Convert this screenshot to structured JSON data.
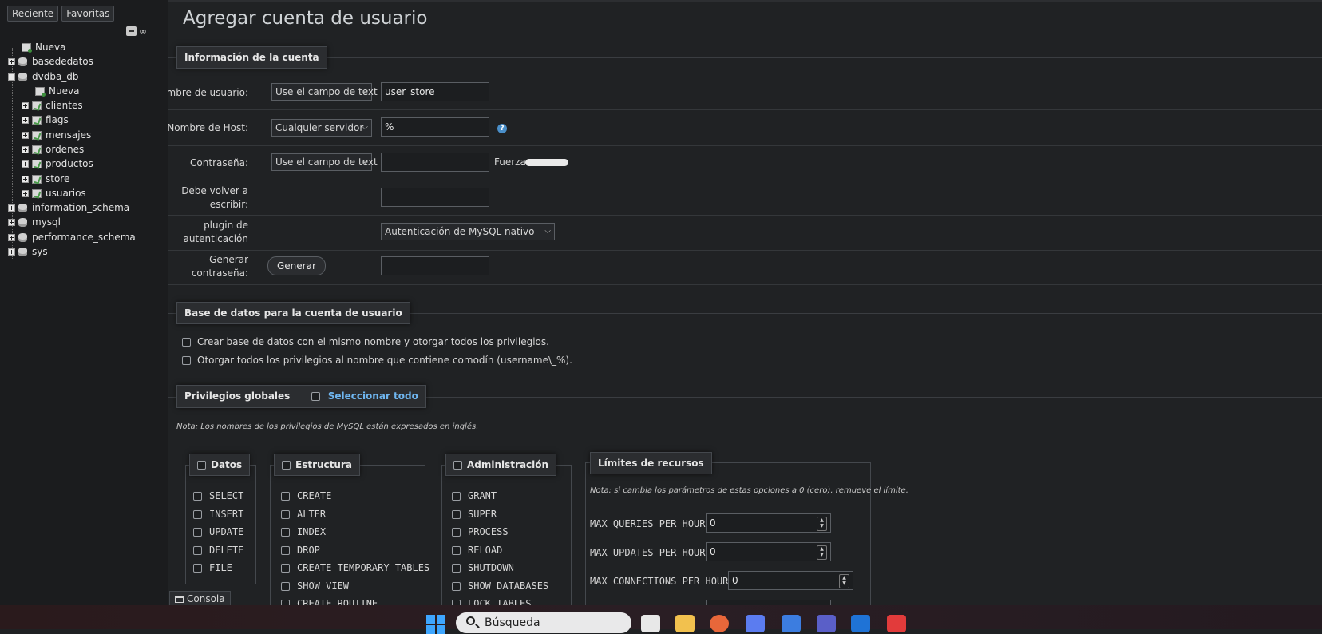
{
  "sidebar": {
    "recent_label": "Reciente",
    "favorites_label": "Favoritas",
    "link_glyph": "∞",
    "tree": {
      "new_root": "Nueva",
      "db1": "basededatos",
      "db2": "dvdba_db",
      "db2_new": "Nueva",
      "tables": [
        "clientes",
        "flags",
        "mensajes",
        "ordenes",
        "productos",
        "store",
        "usuarios"
      ],
      "db3": "information_schema",
      "db4": "mysql",
      "db5": "performance_schema",
      "db6": "sys"
    }
  },
  "main": {
    "title": "Agregar cuenta de usuario",
    "account": {
      "legend": "Información de la cuenta",
      "username_label": "Nombre de usuario:",
      "username_mode": "Use el campo de text",
      "username_value": "user_store",
      "host_label": "Nombre de Host:",
      "host_mode": "Cualquier servidor",
      "host_value": "%",
      "password_label": "Contraseña:",
      "password_mode": "Use el campo de text",
      "strength_label": "Fuerza:",
      "retype_label_1": "Debe volver a",
      "retype_label_2": "escribir:",
      "plugin_label_1": "plugin de",
      "plugin_label_2": "autenticación",
      "plugin_value": "Autenticación de MySQL nativo",
      "generate_label_1": "Generar",
      "generate_label_2": "contraseña:",
      "generate_button": "Generar"
    },
    "database": {
      "legend": "Base de datos para la cuenta de usuario",
      "option1": "Crear base de datos con el mismo nombre y otorgar todos los privilegios.",
      "option2": "Otorgar todos los privilegios al nombre que contiene comodín (username\\_%)."
    },
    "global": {
      "legend": "Privilegios globales",
      "select_all": "Seleccionar todo",
      "note": "Nota: Los nombres de los privilegios de MySQL están expresados en inglés.",
      "data_legend": "Datos",
      "data_privs": [
        "SELECT",
        "INSERT",
        "UPDATE",
        "DELETE",
        "FILE"
      ],
      "structure_legend": "Estructura",
      "structure_privs": [
        "CREATE",
        "ALTER",
        "INDEX",
        "DROP",
        "CREATE TEMPORARY TABLES",
        "SHOW VIEW",
        "CREATE ROUTINE"
      ],
      "admin_legend": "Administración",
      "admin_privs": [
        "GRANT",
        "SUPER",
        "PROCESS",
        "RELOAD",
        "SHUTDOWN",
        "SHOW DATABASES",
        "LOCK TABLES"
      ],
      "limits_legend": "Límites de recursos",
      "limits_note": "Nota: si cambia los parámetros de estas opciones a 0 (cero), remueve el límite.",
      "limits": [
        {
          "label": "MAX QUERIES PER HOUR",
          "value": "0"
        },
        {
          "label": "MAX UPDATES PER HOUR",
          "value": "0"
        },
        {
          "label": "MAX CONNECTIONS PER HOUR",
          "value": "0"
        }
      ]
    },
    "console_label": "Consola"
  },
  "taskbar": {
    "search_placeholder": "Búsqueda",
    "accent": "#3ea6ff"
  }
}
